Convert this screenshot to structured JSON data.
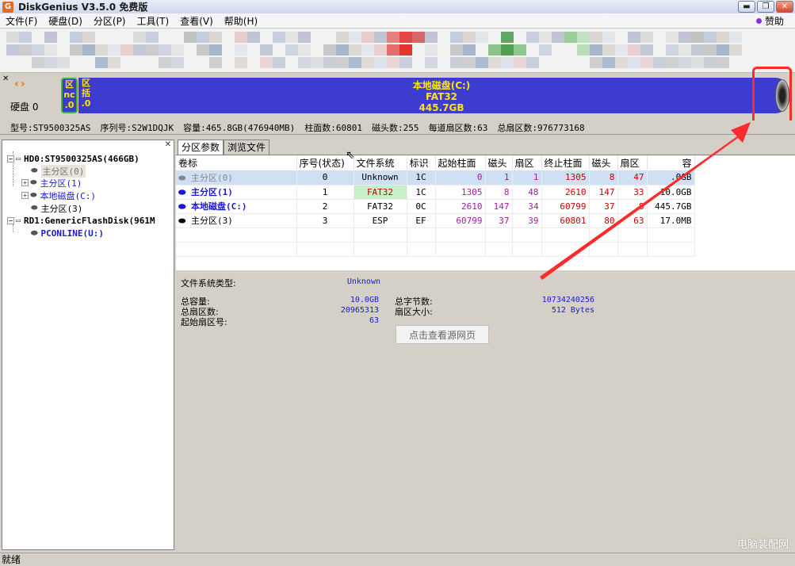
{
  "window": {
    "title": "DiskGenius V3.5.0 免费版",
    "app_icon": "G"
  },
  "menu": {
    "items": [
      "文件(F)",
      "硬盘(D)",
      "分区(P)",
      "工具(T)",
      "查看(V)",
      "帮助(H)"
    ],
    "help": "赞助"
  },
  "diskmap": {
    "nav_prev": "‹",
    "nav_next": "›",
    "disk_label": "硬盘 0",
    "left_part_text": "区\nnc\n.0",
    "left_part2_text": "区\n括\n.0",
    "main_name": "本地磁盘(C:)",
    "main_fs": "FAT32",
    "main_size": "445.7GB"
  },
  "diskinfo": {
    "model": "型号:ST9500325AS",
    "serial": "序列号:S2W1DQJK",
    "capacity": "容量:465.8GB(476940MB)",
    "cylinders": "柱面数:60801",
    "heads": "磁头数:255",
    "sectors_per_track": "每道扇区数:63",
    "total_sectors": "总扇区数:976773168"
  },
  "tree": {
    "hd0": "HD0:ST9500325AS(466GB)",
    "hd0_parts": [
      "主分区(0)",
      "主分区(1)",
      "本地磁盘(C:)",
      "主分区(3)"
    ],
    "rd1": "RD1:GenericFlashDisk(961M",
    "rd1_parts": [
      "PCONLINE(U:)"
    ]
  },
  "tabs": [
    "分区参数",
    "浏览文件"
  ],
  "table": {
    "headers": [
      "卷标",
      "序号(状态)",
      "文件系统",
      "标识",
      "起始柱面",
      "磁头",
      "扇区",
      "终止柱面",
      "磁头",
      "扇区",
      "容"
    ],
    "rows": [
      {
        "label": "主分区(0)",
        "index": "0",
        "fs": "Unknown",
        "id": "1C",
        "start_cyl": "0",
        "start_head": "1",
        "start_sec": "1",
        "end_cyl": "1305",
        "end_head": "8",
        "end_sec": "47",
        "size": ".0GB"
      },
      {
        "label": "主分区(1)",
        "index": "1",
        "fs": "FAT32",
        "id": "1C",
        "start_cyl": "1305",
        "start_head": "8",
        "start_sec": "48",
        "end_cyl": "2610",
        "end_head": "147",
        "end_sec": "33",
        "size": "10.0GB"
      },
      {
        "label": "本地磁盘(C:)",
        "index": "2",
        "fs": "FAT32",
        "id": "0C",
        "start_cyl": "2610",
        "start_head": "147",
        "start_sec": "34",
        "end_cyl": "60799",
        "end_head": "37",
        "end_sec": "8",
        "size": "445.7GB"
      },
      {
        "label": "主分区(3)",
        "index": "3",
        "fs": "ESP",
        "id": "EF",
        "start_cyl": "60799",
        "start_head": "37",
        "start_sec": "39",
        "end_cyl": "60801",
        "end_head": "80",
        "end_sec": "63",
        "size": "17.0MB"
      }
    ]
  },
  "details": {
    "fs_type_label": "文件系统类型:",
    "fs_type_value": "Unknown",
    "total_capacity_label": "总容量:",
    "total_capacity_value": "10.0GB",
    "total_sectors_label": "总扇区数:",
    "total_sectors_value": "20965313",
    "start_sector_label": "起始扇区号:",
    "start_sector_value": "63",
    "total_bytes_label": "总字节数:",
    "total_bytes_value": "10734240256",
    "sector_size_label": "扇区大小:",
    "sector_size_value": "512 Bytes"
  },
  "tooltip": "点击查看源网页",
  "status": "就绪",
  "watermark": "电脑装配网",
  "colors": {
    "partition_blue": "#3c3cd0",
    "partition_text": "#ffe600",
    "annotation_red": "#ff2a2a",
    "selected_row": "#cfe0f5"
  }
}
